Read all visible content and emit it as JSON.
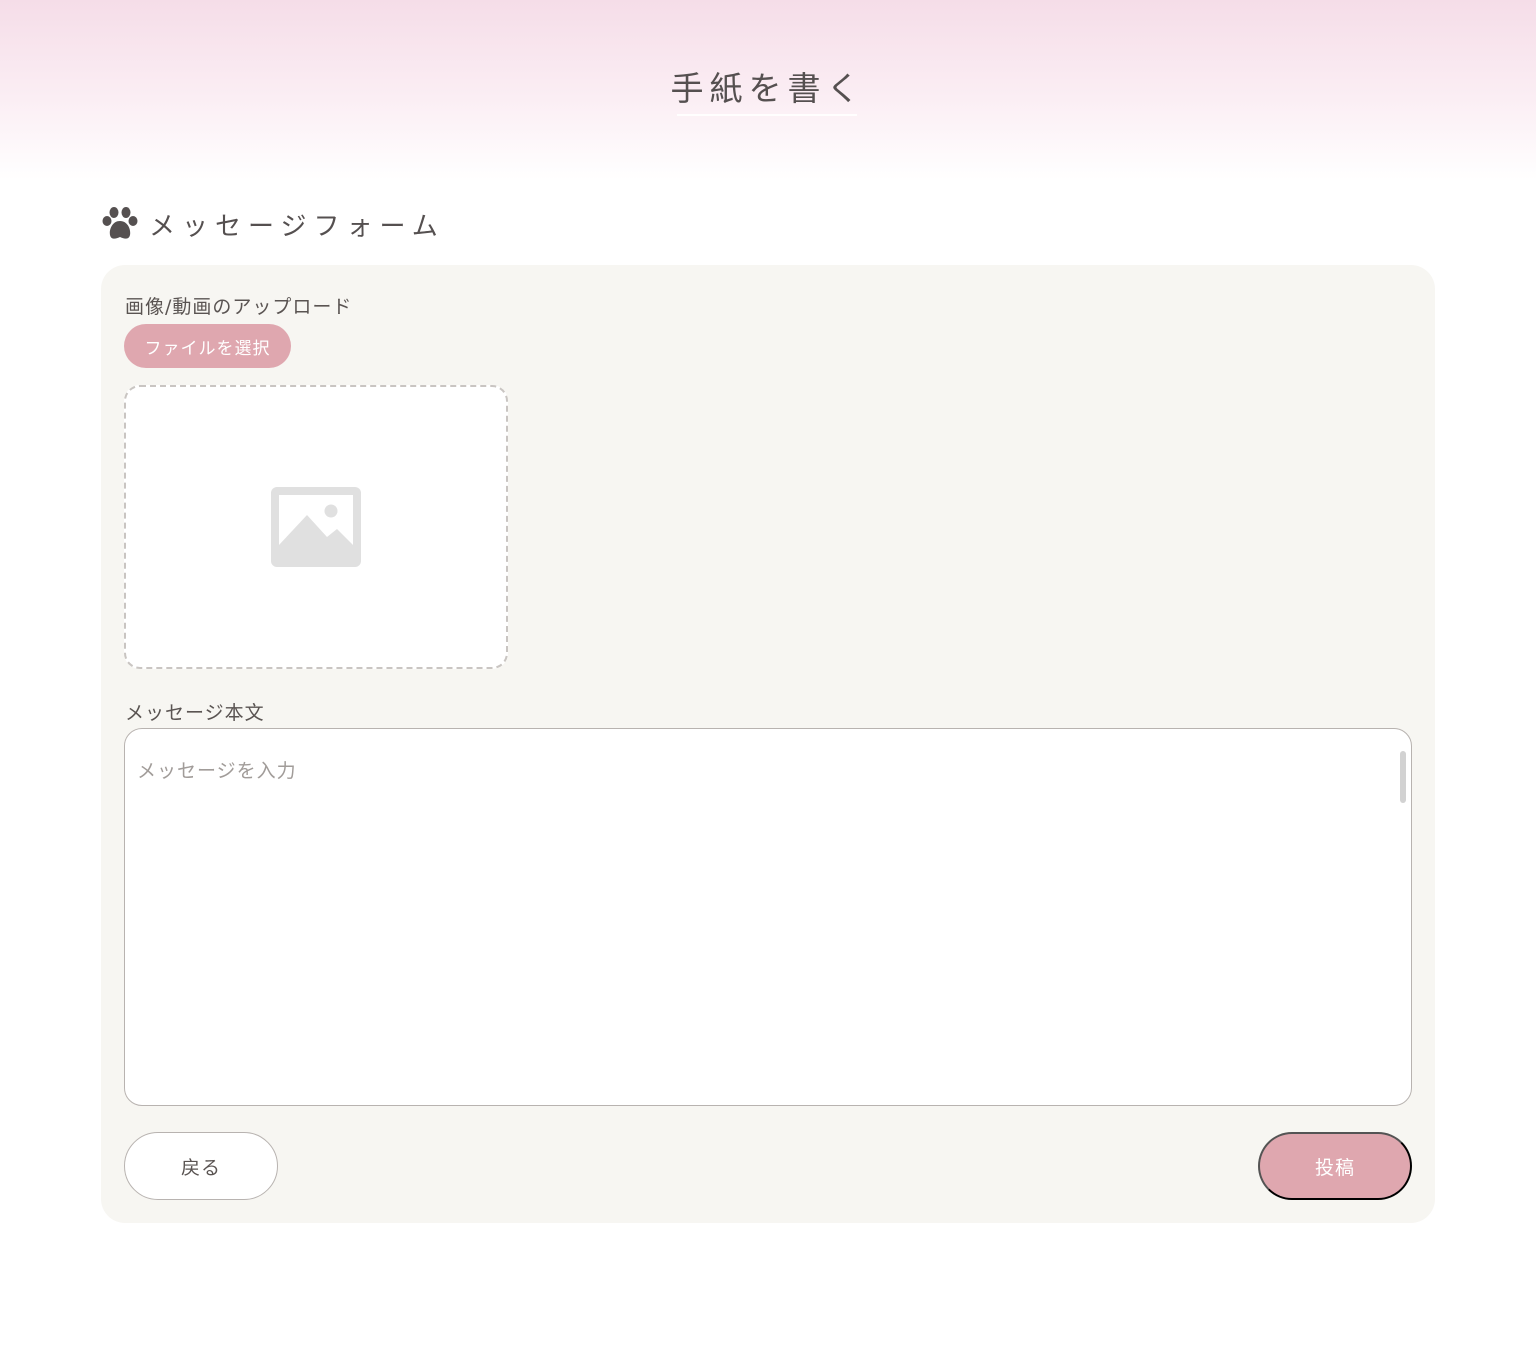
{
  "header": {
    "title": "手紙を書く"
  },
  "section": {
    "title": "メッセージフォーム",
    "icon": "paw-icon"
  },
  "upload": {
    "label": "画像/動画のアップロード",
    "button_label": "ファイルを選択",
    "placeholder_icon": "image-placeholder-icon"
  },
  "message": {
    "label": "メッセージ本文",
    "placeholder": "メッセージを入力",
    "value": ""
  },
  "actions": {
    "back_label": "戻る",
    "submit_label": "投稿"
  },
  "colors": {
    "accent": "#dfa7af",
    "card_bg": "#f7f6f2",
    "header_gradient_top": "#f5dde8",
    "text": "#5a5452"
  }
}
